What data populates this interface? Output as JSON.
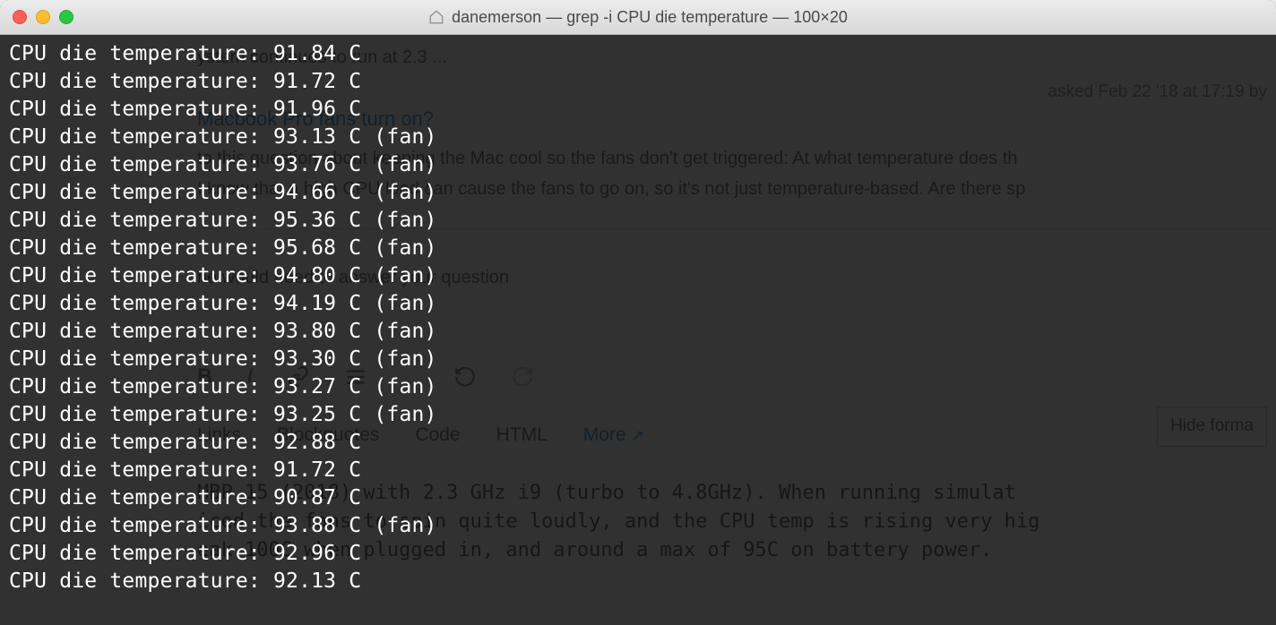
{
  "window": {
    "title": "danemerson — grep -i CPU die temperature — 100×20"
  },
  "terminal": {
    "label_prefix": "CPU die temperature:",
    "unit": "C",
    "fan_suffix": "(fan)",
    "lines": [
      {
        "value": "91.84",
        "fan": false
      },
      {
        "value": "91.72",
        "fan": false
      },
      {
        "value": "91.96",
        "fan": false
      },
      {
        "value": "93.13",
        "fan": true
      },
      {
        "value": "93.76",
        "fan": true
      },
      {
        "value": "94.66",
        "fan": true
      },
      {
        "value": "95.36",
        "fan": true
      },
      {
        "value": "95.68",
        "fan": true
      },
      {
        "value": "94.80",
        "fan": true
      },
      {
        "value": "94.19",
        "fan": true
      },
      {
        "value": "93.80",
        "fan": true
      },
      {
        "value": "93.30",
        "fan": true
      },
      {
        "value": "93.27",
        "fan": true
      },
      {
        "value": "93.25",
        "fan": true
      },
      {
        "value": "92.88",
        "fan": false
      },
      {
        "value": "91.72",
        "fan": false
      },
      {
        "value": "90.87",
        "fan": false
      },
      {
        "value": "93.88",
        "fan": true
      },
      {
        "value": "92.96",
        "fan": false
      },
      {
        "value": "92.13",
        "fan": false
      }
    ]
  },
  "background_page": {
    "snippet_top": "ystem continues to run at 2.3 ...",
    "asked": "asked Feb 22 '18 at 17:19 by",
    "question_title": "Macbook Pro fans turn on?",
    "para1": "to this question about keeping the Mac cool so the fans don't get triggered: At what temperature does th",
    "para2": "I know that a high CPU load can cause the fans to go on, so it's not just temperature-based. Are there sp",
    "login_prompt": "ne would need to answer your question",
    "hide_formatting": "Hide forma",
    "tabs": {
      "links": "Links",
      "blockquotes": "Blockquotes",
      "code": "Code",
      "html": "HTML",
      "more": "More"
    },
    "mono_block": [
      "MBP 15 (2018) with 2.3 GHz i9 (turbo to 4.8GHz). When running simulat",
      "iced the fans to spin quite loudly, and the CPU temp is rising very hig",
      "eak 100C when plugged in, and around a max of 95C on battery power."
    ]
  }
}
